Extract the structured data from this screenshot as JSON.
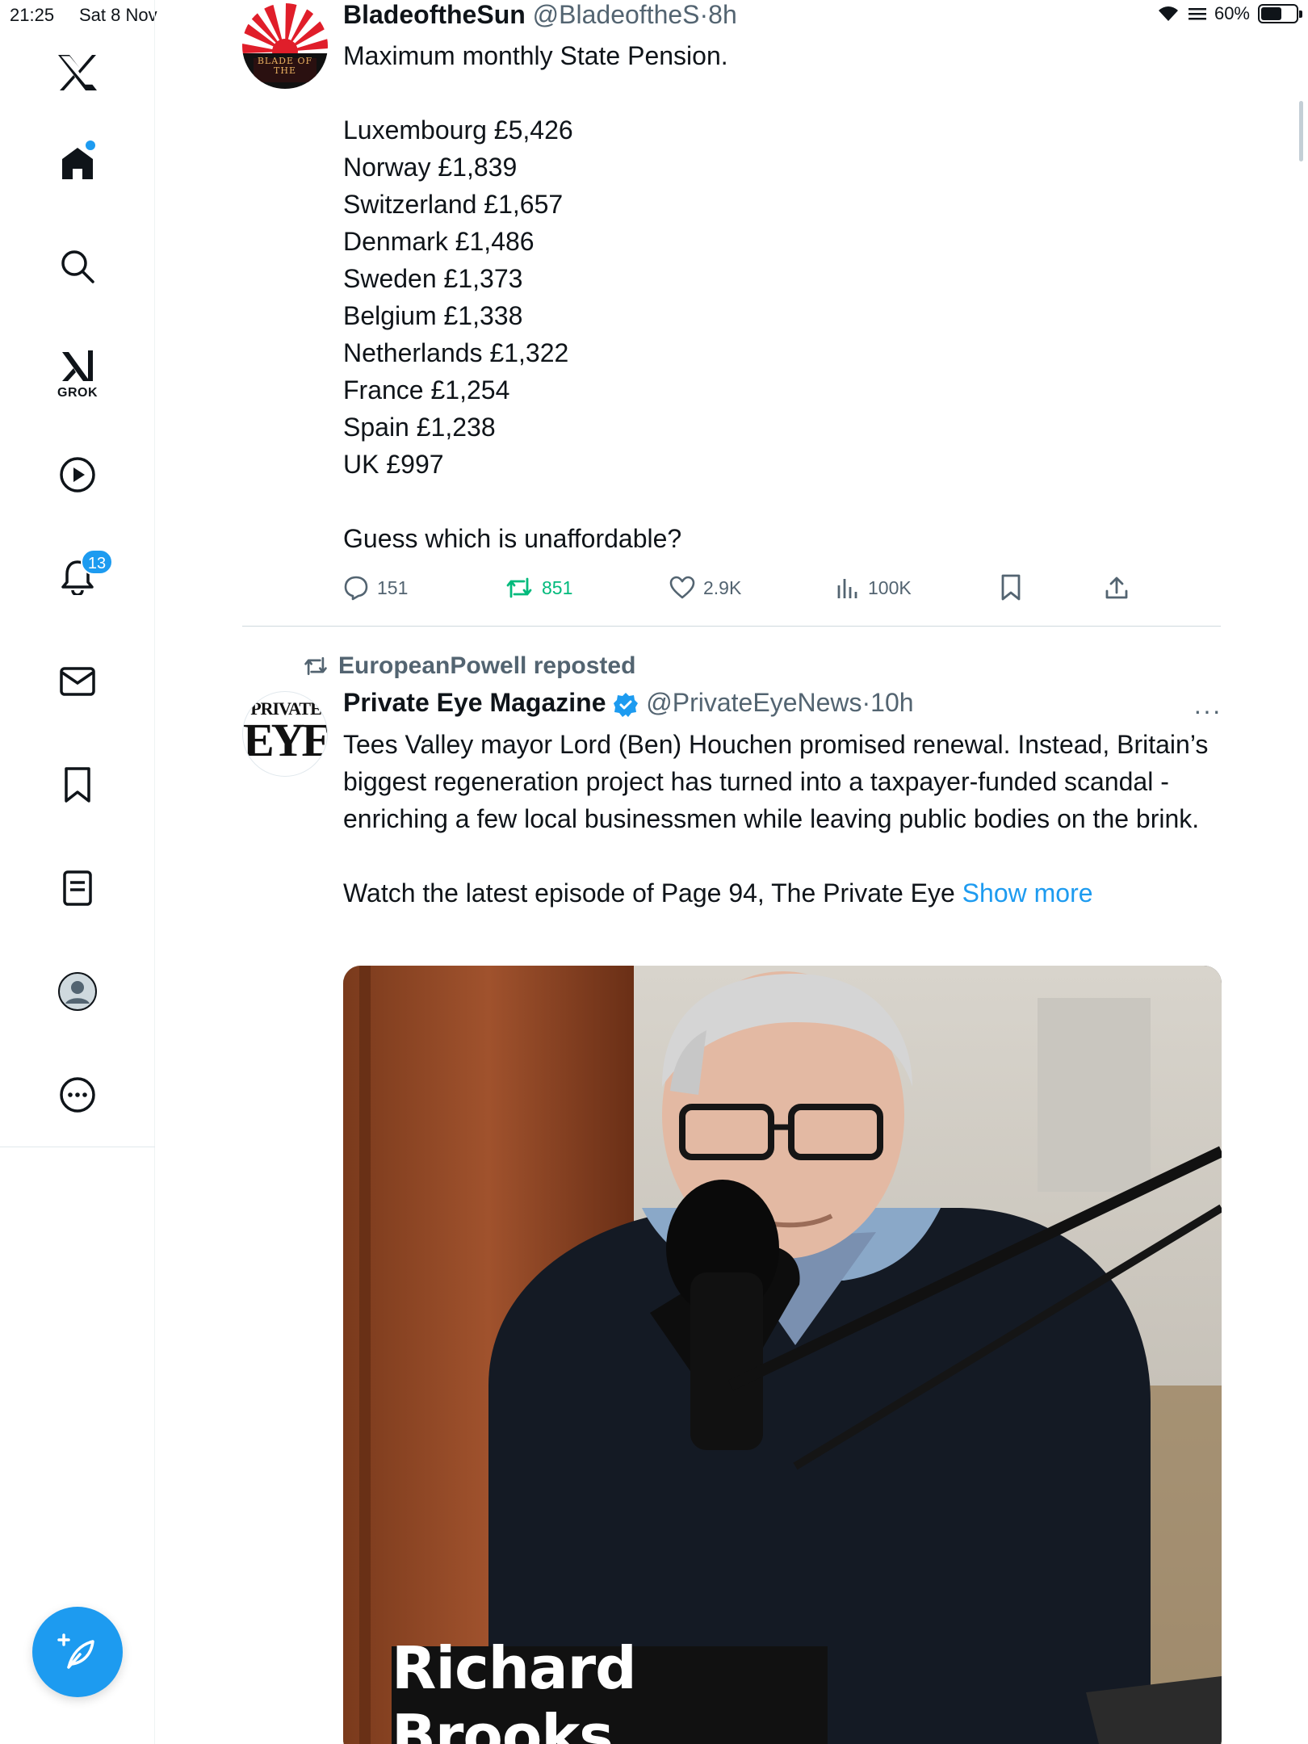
{
  "status_bar": {
    "time": "21:25",
    "date": "Sat 8 Nov",
    "battery": "60%",
    "battery_level": 0.6
  },
  "sidebar": {
    "grok_label": "GROK",
    "notifications_badge": "13"
  },
  "tweet1": {
    "author_name": "BladeoftheSun",
    "handle": "@BladeoftheS",
    "separator": "·",
    "time": "8h",
    "text": "Maximum monthly State Pension.\n\nLuxembourg £5,426\nNorway £1,839\nSwitzerland £1,657\nDenmark £1,486\nSweden £1,373\nBelgium £1,338\nNetherlands £1,322\nFrance £1,254\nSpain £1,238\nUK £997\n\nGuess which is unaffordable?",
    "avatar_text": "BLADE OF THE",
    "counts": {
      "replies": "151",
      "reposts": "851",
      "likes": "2.9K",
      "views": "100K"
    }
  },
  "tweet2": {
    "repost_label": "EuropeanPowell reposted",
    "author_name": "Private Eye Magazine",
    "handle": "@PrivateEyeNews",
    "separator": "·",
    "time": "10h",
    "more": "···",
    "text": "Tees Valley mayor Lord (Ben) Houchen promised renewal. Instead, Britain’s biggest regeneration project has turned into a taxpayer-funded scandal - enriching a few local businessmen while leaving public bodies on the brink.\n\nWatch the latest episode of Page 94, The Private Eye ",
    "show_more": "Show more",
    "avatar_line1": "PRIVATE",
    "avatar_line2": "EYE",
    "video_caption": "Richard Brooks"
  },
  "colors": {
    "accent": "#1d9bf0",
    "repost_green": "#00ba7c",
    "muted": "#536471"
  }
}
